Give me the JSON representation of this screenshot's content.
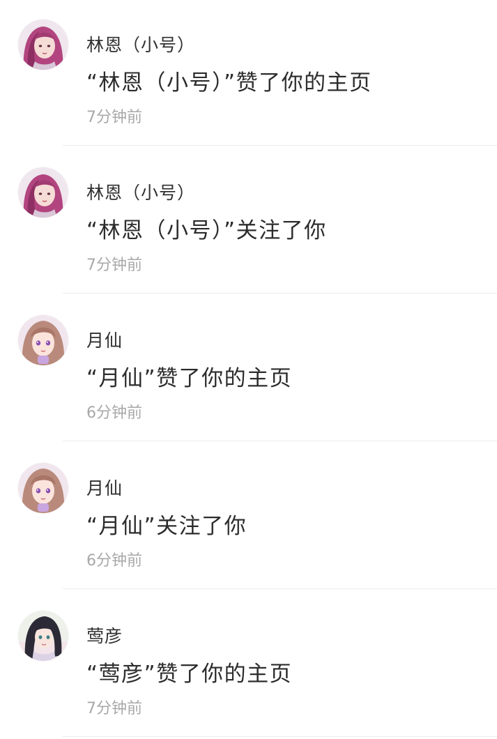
{
  "notifications": [
    {
      "name": "林恩（小号）",
      "message": "“林恩（小号）”赞了你的主页",
      "time": "7分钟前",
      "avatar": "avatar-pink-hair-girl"
    },
    {
      "name": "林恩（小号）",
      "message": "“林恩（小号）”关注了你",
      "time": "7分钟前",
      "avatar": "avatar-pink-hair-girl"
    },
    {
      "name": "月仙",
      "message": "“月仙”赞了你的主页",
      "time": "6分钟前",
      "avatar": "avatar-anime-girl-brown-hair"
    },
    {
      "name": "月仙",
      "message": "“月仙”关注了你",
      "time": "6分钟前",
      "avatar": "avatar-anime-girl-brown-hair"
    },
    {
      "name": "莺彦",
      "message": "“莺彦”赞了你的主页",
      "time": "7分钟前",
      "avatar": "avatar-anime-girl-dark-hair"
    }
  ],
  "colors": {
    "name_text": "#2f2f2f",
    "message_text": "#2c2c2c",
    "time_text": "#a8a8a8",
    "divider": "#ececec"
  }
}
